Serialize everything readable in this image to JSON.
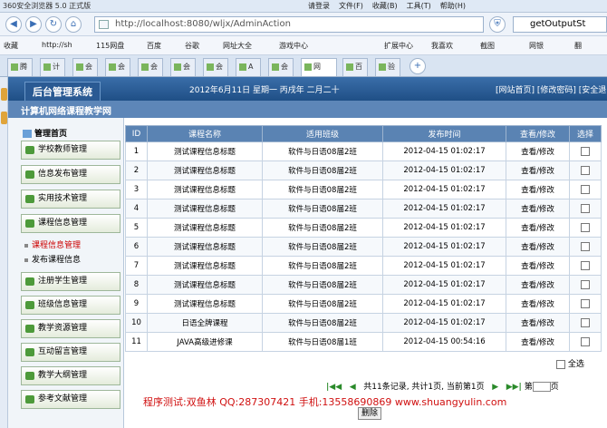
{
  "browser": {
    "title": "360安全浏览器 5.0 正式版",
    "menu": [
      "请登录",
      "文件(F)",
      "收藏(B)",
      "工具(T)",
      "帮助(H)"
    ],
    "url": "http://localhost:8080/wljx/AdminAction",
    "search_text": "getOutputSt",
    "favorites": [
      "收藏",
      "http://sh",
      "115网盘",
      "百度",
      "谷歌",
      "网址大全",
      "游戏中心",
      "扩展中心",
      "我喜欢",
      "截图",
      "网银",
      "翻"
    ],
    "tabs": [
      "腾",
      "计",
      "会",
      "会",
      "会",
      "会",
      "会",
      "A",
      "会",
      "网",
      "百",
      "验"
    ]
  },
  "header": {
    "logo": "后台管理系统",
    "date": "2012年6月11日 星期一 丙戌年 二月二十",
    "links": "[网站首页] [修改密码] [安全退",
    "subtitle": "计算机网络课程教学网"
  },
  "nav": {
    "home": "管理首页",
    "items": [
      "学校教师管理",
      "信息发布管理",
      "实用技术管理",
      "课程信息管理",
      "注册学生管理",
      "班级信息管理",
      "教学资源管理",
      "互动留言管理",
      "教学大纲管理",
      "参考文献管理"
    ],
    "subitems": [
      "课程信息管理",
      "发布课程信息"
    ]
  },
  "table": {
    "headers": [
      "ID",
      "课程名称",
      "适用班级",
      "发布时间",
      "查看/修改",
      "选择"
    ],
    "rows": [
      [
        "1",
        "测试课程信息标题",
        "软件与日语08届2班",
        "2012-04-15 01:02:17",
        "查看/修改"
      ],
      [
        "2",
        "测试课程信息标题",
        "软件与日语08届2班",
        "2012-04-15 01:02:17",
        "查看/修改"
      ],
      [
        "3",
        "测试课程信息标题",
        "软件与日语08届2班",
        "2012-04-15 01:02:17",
        "查看/修改"
      ],
      [
        "4",
        "测试课程信息标题",
        "软件与日语08届2班",
        "2012-04-15 01:02:17",
        "查看/修改"
      ],
      [
        "5",
        "测试课程信息标题",
        "软件与日语08届2班",
        "2012-04-15 01:02:17",
        "查看/修改"
      ],
      [
        "6",
        "测试课程信息标题",
        "软件与日语08届2班",
        "2012-04-15 01:02:17",
        "查看/修改"
      ],
      [
        "7",
        "测试课程信息标题",
        "软件与日语08届2班",
        "2012-04-15 01:02:17",
        "查看/修改"
      ],
      [
        "8",
        "测试课程信息标题",
        "软件与日语08届2班",
        "2012-04-15 01:02:17",
        "查看/修改"
      ],
      [
        "9",
        "测试课程信息标题",
        "软件与日语08届2班",
        "2012-04-15 01:02:17",
        "查看/修改"
      ],
      [
        "10",
        "日语全牌课程",
        "软件与日语08届2班",
        "2012-04-15 01:02:17",
        "查看/修改"
      ],
      [
        "11",
        "JAVA高级进修课",
        "软件与日语08届1班",
        "2012-04-15 00:54:16",
        "查看/修改"
      ]
    ]
  },
  "select_all": "全选",
  "pager": {
    "info": "共11条记录, 共计1页, 当前第1页",
    "pre": "第",
    "post": "页"
  },
  "promo": "程序测试:双鱼林 QQ:287307421 手机:13558690869 www.shuangyulin.com",
  "delete_label": "删除"
}
